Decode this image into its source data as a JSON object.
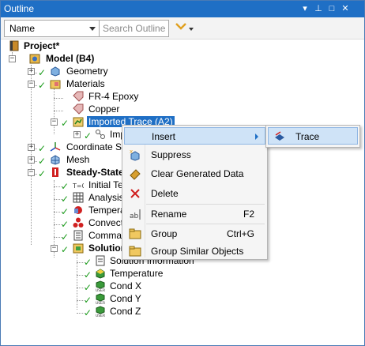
{
  "window": {
    "title": "Outline",
    "buttons": {
      "dropdown": "▾",
      "pin": "⊥",
      "maximize": "□",
      "close": "✕"
    }
  },
  "toolbar": {
    "name_select": {
      "value": "Name"
    },
    "search": {
      "placeholder": "Search Outline"
    }
  },
  "tree": {
    "project": "Project*",
    "model": "Model (B4)",
    "geometry": "Geometry",
    "materials": "Materials",
    "fr4": "FR-4 Epoxy",
    "copper": "Copper",
    "imported_trace": "Imported Trace (A2)",
    "imported_child": "Imp",
    "coordinate_systems": "Coordinate Sys",
    "mesh": "Mesh",
    "steady_state": "Steady-State",
    "initial_temp": "Initial Ter",
    "analysis_settings": "Analysis S",
    "temperature_load": "Temperat",
    "convection": "Convectio",
    "commands": "Comman",
    "solution": "Solution",
    "solution_information": "Solution Information",
    "temperature_result": "Temperature",
    "cond_x": "Cond X",
    "cond_y": "Cond Y",
    "cond_z": "Cond Z"
  },
  "context_menu": {
    "insert": "Insert",
    "suppress": "Suppress",
    "clear_generated_data": "Clear Generated Data",
    "delete": "Delete",
    "rename": "Rename",
    "rename_shortcut": "F2",
    "group": "Group",
    "group_shortcut": "Ctrl+G",
    "group_similar": "Group Similar Objects"
  },
  "submenu": {
    "trace": "Trace"
  },
  "colors": {
    "accent": "#1f6fc5",
    "check": "#1a9b1a",
    "highlight": "#cfe3f7"
  }
}
